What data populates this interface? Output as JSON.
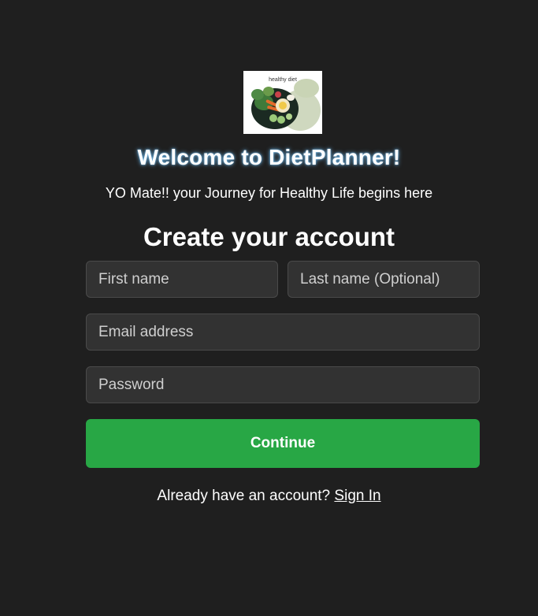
{
  "logo": {
    "caption": "healthy diet",
    "icon": "salad-bowl-logo"
  },
  "header": {
    "welcome": "Welcome to DietPlanner!",
    "tagline": "YO Mate!! your Journey for Healthy Life begins here"
  },
  "form": {
    "title": "Create your account",
    "first_name_placeholder": "First name",
    "last_name_placeholder": "Last name (Optional)",
    "email_placeholder": "Email address",
    "password_placeholder": "Password",
    "continue_label": "Continue",
    "accent_color": "#28a745"
  },
  "footer": {
    "prompt": "Already have an account?",
    "signin_label": "Sign In"
  }
}
